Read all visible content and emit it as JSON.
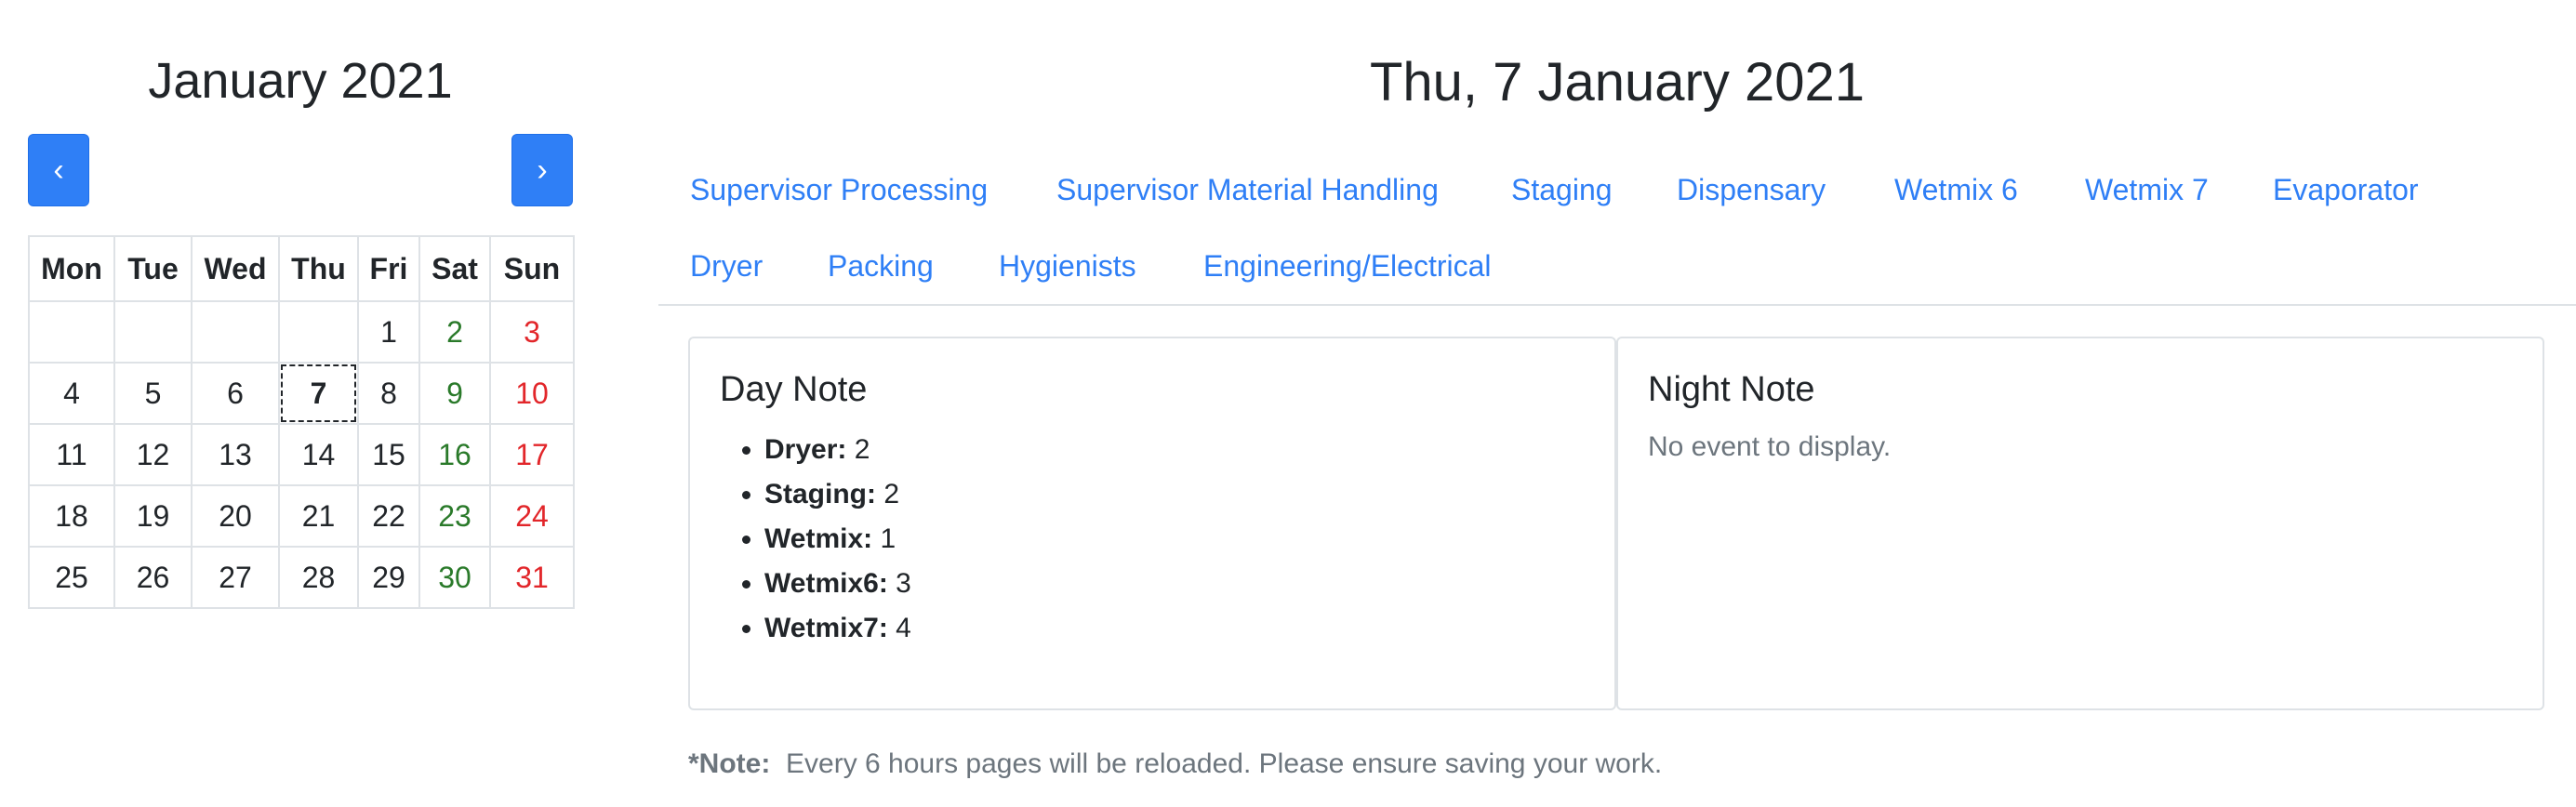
{
  "calendar": {
    "month_title": "January 2021",
    "prev_label": "‹",
    "next_label": "›",
    "weekdays": [
      "Mon",
      "Tue",
      "Wed",
      "Thu",
      "Fri",
      "Sat",
      "Sun"
    ],
    "weeks": [
      [
        "",
        "",
        "",
        "",
        "1",
        "2",
        "3"
      ],
      [
        "4",
        "5",
        "6",
        "7",
        "8",
        "9",
        "10"
      ],
      [
        "11",
        "12",
        "13",
        "14",
        "15",
        "16",
        "17"
      ],
      [
        "18",
        "19",
        "20",
        "21",
        "22",
        "23",
        "24"
      ],
      [
        "25",
        "26",
        "27",
        "28",
        "29",
        "30",
        "31"
      ]
    ],
    "selected_day": "7"
  },
  "main": {
    "date_title": "Thu, 7 January 2021",
    "tabs": [
      "Supervisor Processing",
      "Supervisor Material Handling",
      "Staging",
      "Dispensary",
      "Wetmix 6",
      "Wetmix 7",
      "Evaporator",
      "Dryer",
      "Packing",
      "Hygienists",
      "Engineering/Electrical"
    ],
    "day_note": {
      "title": "Day Note",
      "items": [
        {
          "label": "Dryer:",
          "value": "2"
        },
        {
          "label": "Staging:",
          "value": "2"
        },
        {
          "label": "Wetmix:",
          "value": "1"
        },
        {
          "label": "Wetmix6:",
          "value": "3"
        },
        {
          "label": "Wetmix7:",
          "value": "4"
        }
      ]
    },
    "night_note": {
      "title": "Night Note",
      "empty_message": "No event to display."
    },
    "footer": {
      "prefix": "*Note:",
      "text": "Every 6 hours pages will be reloaded. Please ensure saving your work."
    }
  },
  "colors": {
    "accent": "#2f7ff6",
    "saturday": "#2a7a2a",
    "sunday": "#e2262a",
    "muted": "#6c757d"
  }
}
